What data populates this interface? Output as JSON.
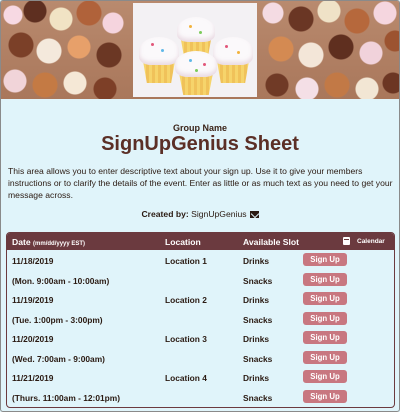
{
  "header": {
    "group_name": "Group Name",
    "title": "SignUpGenius Sheet",
    "description": "This area allows you to enter descriptive text about your sign up. Use it to give your members instructions or to clarify the details of the event. Enter as little or as much text as you need to get your message across.",
    "created_by_label": "Created by:",
    "created_by_name": "SignUpGenius"
  },
  "table": {
    "columns": {
      "date": "Date",
      "date_format": "(mm/dd/yyyy EST)",
      "location": "Location",
      "slot": "Available Slot",
      "calendar": "Calendar"
    },
    "signup_label": "Sign Up",
    "events": [
      {
        "date": "11/18/2019",
        "time": "(Mon. 9:00am - 10:00am)",
        "location": "Location 1",
        "slots": [
          "Drinks",
          "Snacks"
        ]
      },
      {
        "date": "11/19/2019",
        "time": "(Tue. 1:00pm - 3:00pm)",
        "location": "Location 2",
        "slots": [
          "Drinks",
          "Snacks"
        ]
      },
      {
        "date": "11/20/2019",
        "time": "(Wed. 7:00am - 9:00am)",
        "location": "Location 3",
        "slots": [
          "Drinks",
          "Snacks"
        ]
      },
      {
        "date": "11/21/2019",
        "time": "(Thurs. 11:00am - 12:01pm)",
        "location": "Location 4",
        "slots": [
          "Drinks",
          "Snacks"
        ]
      }
    ]
  },
  "colors": {
    "background": "#e0f4fa",
    "header_bar": "#6b3a3f",
    "signup_button": "#c87780",
    "title": "#5b2f26"
  }
}
